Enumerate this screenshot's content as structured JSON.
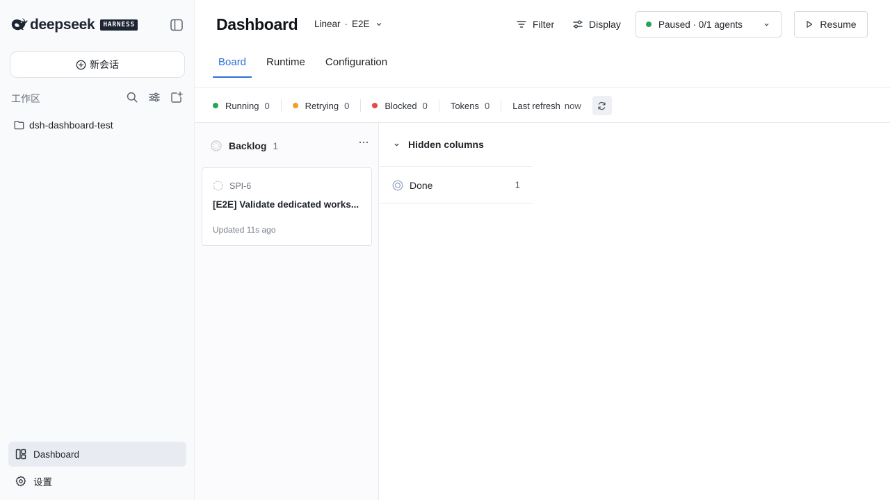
{
  "sidebar": {
    "brand_name": "deepseek",
    "brand_badge": "HARNESS",
    "new_chat_label": "新会话",
    "workspace_title": "工作区",
    "workspace_items": [
      {
        "label": "dsh-dashboard-test",
        "icon": "folder-icon"
      }
    ],
    "nav": {
      "dashboard": {
        "label": "Dashboard",
        "icon": "dashboard-icon",
        "active": true
      },
      "settings": {
        "label": "设置",
        "icon": "gear-icon"
      }
    }
  },
  "header": {
    "title": "Dashboard",
    "source": {
      "provider": "Linear",
      "separator": "·",
      "project": "E2E"
    },
    "filter_label": "Filter",
    "display_label": "Display",
    "status": {
      "label": "Paused · 0/1 agents",
      "color": "#22a65a"
    },
    "resume_label": "Resume"
  },
  "tabs": [
    {
      "label": "Board",
      "active": true
    },
    {
      "label": "Runtime",
      "active": false
    },
    {
      "label": "Configuration",
      "active": false
    }
  ],
  "stats": {
    "running": {
      "label": "Running",
      "value": "0",
      "color": "#22a65a"
    },
    "retrying": {
      "label": "Retrying",
      "value": "0",
      "color": "#f0a024"
    },
    "blocked": {
      "label": "Blocked",
      "value": "0",
      "color": "#e5484d"
    },
    "tokens": {
      "label": "Tokens",
      "value": "0"
    },
    "last_refresh": {
      "label": "Last refresh",
      "value": "now"
    }
  },
  "board": {
    "backlog": {
      "title": "Backlog",
      "count": "1",
      "cards": [
        {
          "id": "SPI-6",
          "title": "[E2E] Validate dedicated works...",
          "updated": "Updated 11s ago"
        }
      ]
    },
    "hidden": {
      "title": "Hidden columns",
      "columns": [
        {
          "label": "Done",
          "count": "1"
        }
      ]
    }
  },
  "colors": {
    "accent": "#2f6fd6",
    "sidebar_bg": "#f9fafb",
    "active_nav_bg": "#e8ecf2"
  }
}
